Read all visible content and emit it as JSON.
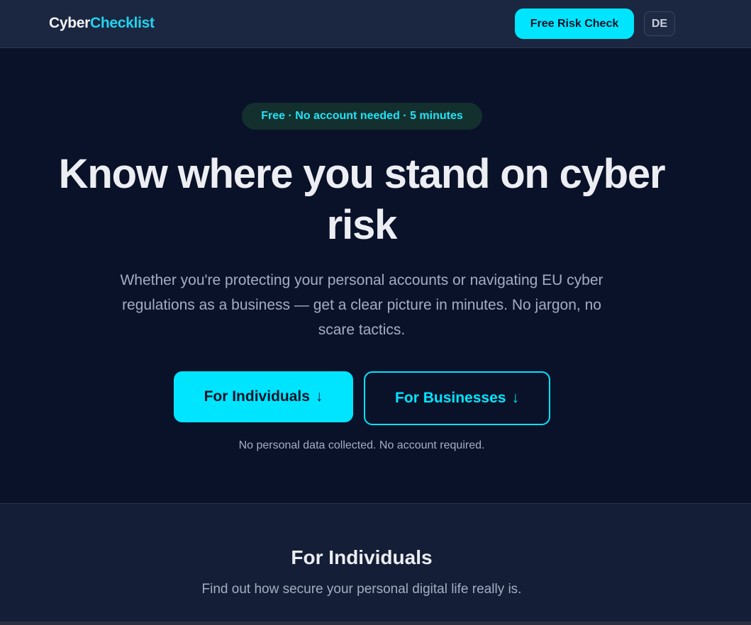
{
  "nav": {
    "logo_part1": "Cyber",
    "logo_part2": "Checklist",
    "cta_label": "Free Risk Check",
    "lang_label": "DE"
  },
  "hero": {
    "pill": "Free · No account needed · 5 minutes",
    "headline": "Know where you stand on cyber risk",
    "subtitle": "Whether you're protecting your personal accounts or navigating EU cyber regulations as a business — get a clear picture in minutes. No jargon, no scare tactics.",
    "btn_individuals": "For Individuals",
    "btn_businesses": "For Businesses",
    "arrow": "↓",
    "note": "No personal data collected. No account required."
  },
  "section": {
    "title": "For Individuals",
    "subtitle": "Find out how secure your personal digital life really is."
  },
  "colors": {
    "accent": "#00e5ff",
    "background": "#0a1229",
    "nav_background": "#1b2640"
  }
}
